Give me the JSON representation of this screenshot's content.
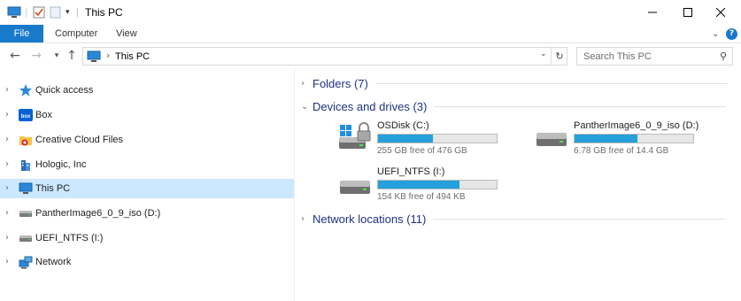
{
  "window": {
    "title": "This PC",
    "controls": [
      "minimize-icon",
      "maximize-icon",
      "close-icon"
    ]
  },
  "ribbon": {
    "tabs": [
      {
        "label": "File",
        "active": true
      },
      {
        "label": "Computer"
      },
      {
        "label": "View"
      }
    ],
    "help_label": "?"
  },
  "address": {
    "location": "This PC",
    "search_placeholder": "Search This PC"
  },
  "sidebar": {
    "items": [
      {
        "label": "Quick access",
        "icon": "star-icon"
      },
      {
        "label": "Box",
        "icon": "box-icon"
      },
      {
        "label": "Creative Cloud Files",
        "icon": "creative-cloud-folder-icon"
      },
      {
        "label": "Hologic, Inc",
        "icon": "building-icon"
      },
      {
        "label": "This PC",
        "icon": "computer-icon",
        "selected": true
      },
      {
        "label": "PantherImage6_0_9_iso (D:)",
        "icon": "drive-icon"
      },
      {
        "label": "UEFI_NTFS (I:)",
        "icon": "drive-icon"
      },
      {
        "label": "Network",
        "icon": "network-icon"
      }
    ]
  },
  "content": {
    "groups": {
      "folders": "Folders (7)",
      "devices": "Devices and drives (3)",
      "network": "Network locations (11)"
    },
    "drives": [
      {
        "name": "OSDisk (C:)",
        "free_text": "255 GB free of 476 GB",
        "used_fraction": 0.46,
        "icon": "windows-drive-locked-icon"
      },
      {
        "name": "PantherImage6_0_9_iso (D:)",
        "free_text": "6.78 GB free of 14.4 GB",
        "used_fraction": 0.53,
        "icon": "drive-icon"
      },
      {
        "name": "UEFI_NTFS (I:)",
        "free_text": "154 KB free of 494 KB",
        "used_fraction": 0.69,
        "icon": "drive-icon"
      }
    ]
  },
  "colors": {
    "accent": "#1979ca",
    "selection": "#cce8ff",
    "bar_fill": "#26a0da",
    "group_header": "#1e3287"
  }
}
